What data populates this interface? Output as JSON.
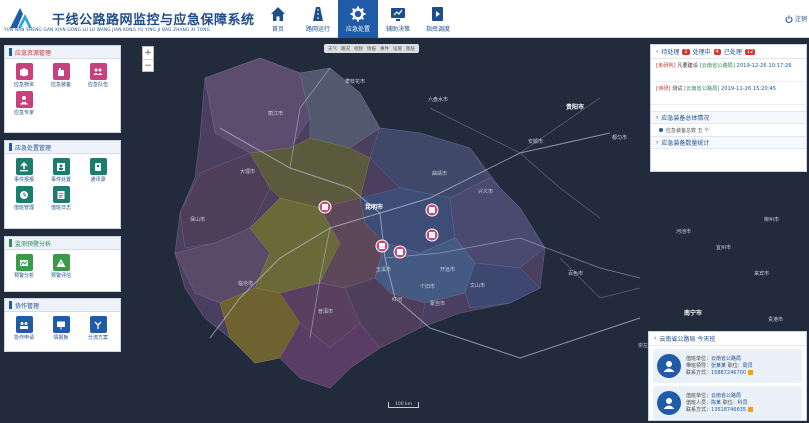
{
  "header": {
    "title_cn": "干线公路路网监控与应急保障系统",
    "title_en": "YUN NAN SHENG GAN XIAN GONG LU LU WANG JIAN KONG YU YING JI BAO ZHANG XI TONG",
    "logout_label": "注销"
  },
  "nav": [
    {
      "label": "首页",
      "icon": "home-icon"
    },
    {
      "label": "路网运行",
      "icon": "road-icon"
    },
    {
      "label": "应急处置",
      "icon": "gear-icon",
      "active": true
    },
    {
      "label": "辅助决策",
      "icon": "decision-icon"
    },
    {
      "label": "指挥调度",
      "icon": "dispatch-icon"
    }
  ],
  "map": {
    "toolbar": [
      "天气",
      "路况",
      "视频",
      "情报",
      "事件",
      "设施",
      "图层"
    ],
    "zoom_in": "+",
    "zoom_out": "−",
    "scale": "100 km",
    "cities": [
      {
        "name": "贵阳市"
      },
      {
        "name": "昆明市"
      },
      {
        "name": "南宁市"
      },
      {
        "name": "攀枝花市"
      },
      {
        "name": "六盘水市"
      },
      {
        "name": "安顺市"
      },
      {
        "name": "兴义市"
      },
      {
        "name": "百色市"
      },
      {
        "name": "都匀市"
      },
      {
        "name": "河池市"
      },
      {
        "name": "柳州市"
      },
      {
        "name": "来宾市"
      },
      {
        "name": "宜州市"
      },
      {
        "name": "贵港市"
      },
      {
        "name": "崇左市"
      },
      {
        "name": "玉溪市"
      },
      {
        "name": "曲靖市"
      },
      {
        "name": "大理市"
      },
      {
        "name": "保山市"
      },
      {
        "name": "丽江市"
      },
      {
        "name": "临沧市"
      },
      {
        "name": "普洱市"
      },
      {
        "name": "文山市"
      },
      {
        "name": "红河"
      },
      {
        "name": "个旧市"
      },
      {
        "name": "开远市"
      },
      {
        "name": "蒙自市"
      }
    ]
  },
  "left_panels": {
    "resource": {
      "title": "应急资源管理",
      "items": [
        {
          "label": "应急物资",
          "icon": "supplies-icon"
        },
        {
          "label": "应急装备",
          "icon": "equipment-icon"
        },
        {
          "label": "应急队伍",
          "icon": "team-icon"
        },
        {
          "label": "应急专家",
          "icon": "expert-icon"
        }
      ]
    },
    "disposal": {
      "title": "应急处置管理",
      "items": [
        {
          "label": "事件报报",
          "icon": "report-icon"
        },
        {
          "label": "事件处置",
          "icon": "handle-icon"
        },
        {
          "label": "通讯录",
          "icon": "contacts-icon"
        },
        {
          "label": "值班管理",
          "icon": "duty-icon"
        },
        {
          "label": "值班日志",
          "icon": "log-icon"
        }
      ]
    },
    "warning": {
      "title": "监测预警分析",
      "items": [
        {
          "label": "预警分析",
          "icon": "warning-analysis-icon"
        },
        {
          "label": "预警评估",
          "icon": "warning-assess-icon"
        }
      ]
    },
    "collab": {
      "title": "协作管理",
      "items": [
        {
          "label": "协作申请",
          "icon": "collab-apply-icon"
        },
        {
          "label": "情报板",
          "icon": "board-icon"
        },
        {
          "label": "分流方案",
          "icon": "diversion-icon"
        }
      ]
    }
  },
  "right_panel": {
    "status": [
      {
        "label": "待处理",
        "count": "2",
        "color": "#d9342b"
      },
      {
        "label": "处理中",
        "count": "4",
        "color": "#d9342b"
      },
      {
        "label": "已处理",
        "count": "12",
        "color": "#d9342b"
      }
    ],
    "events": [
      {
        "tag": "[未研判]",
        "name": "凡要建设",
        "dept": "[云南省公路局]",
        "time": "2019-12-26 10:17:26"
      },
      {
        "tag": "[待研]",
        "name": "测试",
        "dept": "[云南省公路局]",
        "time": "2019-11-26 15:20:45"
      }
    ],
    "equip_overview_title": "应急装备总体情况",
    "equip_overview_row": "应急装备总数  五 个",
    "equip_stats_title": "应急装备数量统计"
  },
  "duty_panel": {
    "title": "云南省公路局 今天班",
    "cards": [
      {
        "unit_label": "值班单位：",
        "unit": "云南省公路局",
        "leader_label": "带班领导：",
        "leader": "张某某",
        "post_label": "职位：",
        "post": "局员",
        "phone_label": "联系方式：",
        "phone": "15887246700"
      },
      {
        "unit_label": "值班单位：",
        "unit": "云南省公路局",
        "leader_label": "值班人员：",
        "leader": "陈某",
        "post_label": "职位：",
        "post": "科员",
        "phone_label": "联系方式：",
        "phone": "13518746635"
      }
    ]
  },
  "colors": {
    "primary": "#1f5ba6",
    "accent_red": "#d9342b",
    "map_bg": "#212b3c"
  }
}
